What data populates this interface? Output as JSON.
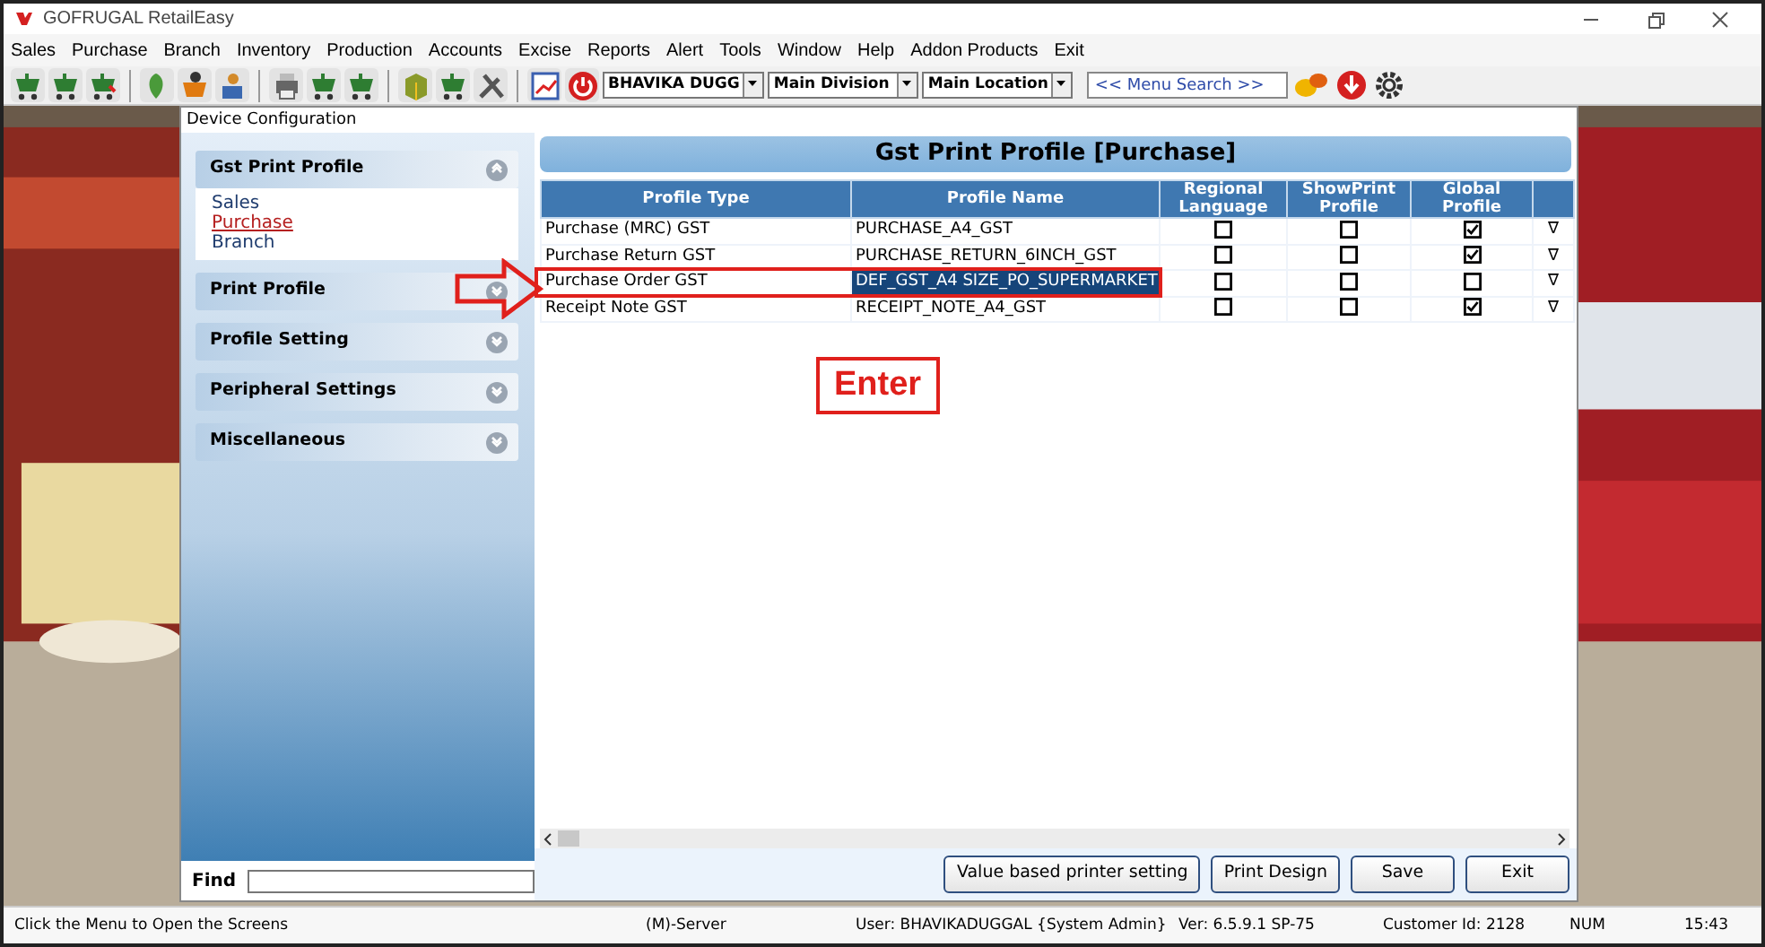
{
  "window": {
    "title": "GOFRUGAL RetailEasy"
  },
  "menu": [
    "Sales",
    "Purchase",
    "Branch",
    "Inventory",
    "Production",
    "Accounts",
    "Excise",
    "Reports",
    "Alert",
    "Tools",
    "Window",
    "Help",
    "Addon Products",
    "Exit"
  ],
  "toolbar": {
    "user_select": "BHAVIKA DUGG",
    "division_select": "Main Division",
    "location_select": "Main Location",
    "menu_search": {
      "placeholder": "<< Menu Search >>"
    }
  },
  "dialog": {
    "title": "Device Configuration",
    "sidebar": [
      {
        "title": "Gst Print Profile",
        "expanded": true,
        "items": [
          {
            "label": "Sales",
            "selected": false
          },
          {
            "label": "Purchase",
            "selected": true
          },
          {
            "label": "Branch",
            "selected": false
          }
        ]
      },
      {
        "title": "Print Profile",
        "expanded": false
      },
      {
        "title": "Profile Setting",
        "expanded": false
      },
      {
        "title": "Peripheral Settings",
        "expanded": false
      },
      {
        "title": "Miscellaneous",
        "expanded": false
      }
    ],
    "find": {
      "label": "Find"
    },
    "panel_title": "Gst Print Profile [Purchase]",
    "columns": [
      "Profile Type",
      "Profile Name",
      "Regional Language",
      "ShowPrint Profile",
      "Global Profile"
    ],
    "rows": [
      {
        "profile_type": "Purchase (MRC) GST",
        "profile_name": "PURCHASE_A4_GST",
        "regional_language": false,
        "show_print_profile": false,
        "global_profile": true,
        "action": "∇",
        "selected": false
      },
      {
        "profile_type": "Purchase Return GST",
        "profile_name": "PURCHASE_RETURN_6INCH_GST",
        "regional_language": false,
        "show_print_profile": false,
        "global_profile": true,
        "action": "∇",
        "selected": false
      },
      {
        "profile_type": "Purchase Order GST",
        "profile_name": "DEF_GST_A4 SIZE_PO_SUPERMARKET",
        "regional_language": false,
        "show_print_profile": false,
        "global_profile": false,
        "action": "∇",
        "selected": true
      },
      {
        "profile_type": "Receipt Note GST",
        "profile_name": "RECEIPT_NOTE_A4_GST",
        "regional_language": false,
        "show_print_profile": false,
        "global_profile": true,
        "action": "∇",
        "selected": false
      }
    ],
    "buttons": [
      "Value based printer setting",
      "Print Design",
      "Save",
      "Exit"
    ]
  },
  "annotation": {
    "label": "Enter"
  },
  "status_bar": [
    "Click the Menu to Open the Screens",
    "(M)-Server",
    "User: BHAVIKADUGGAL {System Admin}",
    "Ver: 6.5.9.1 SP-75",
    "Customer Id: 2128",
    "NUM",
    "15:43"
  ]
}
